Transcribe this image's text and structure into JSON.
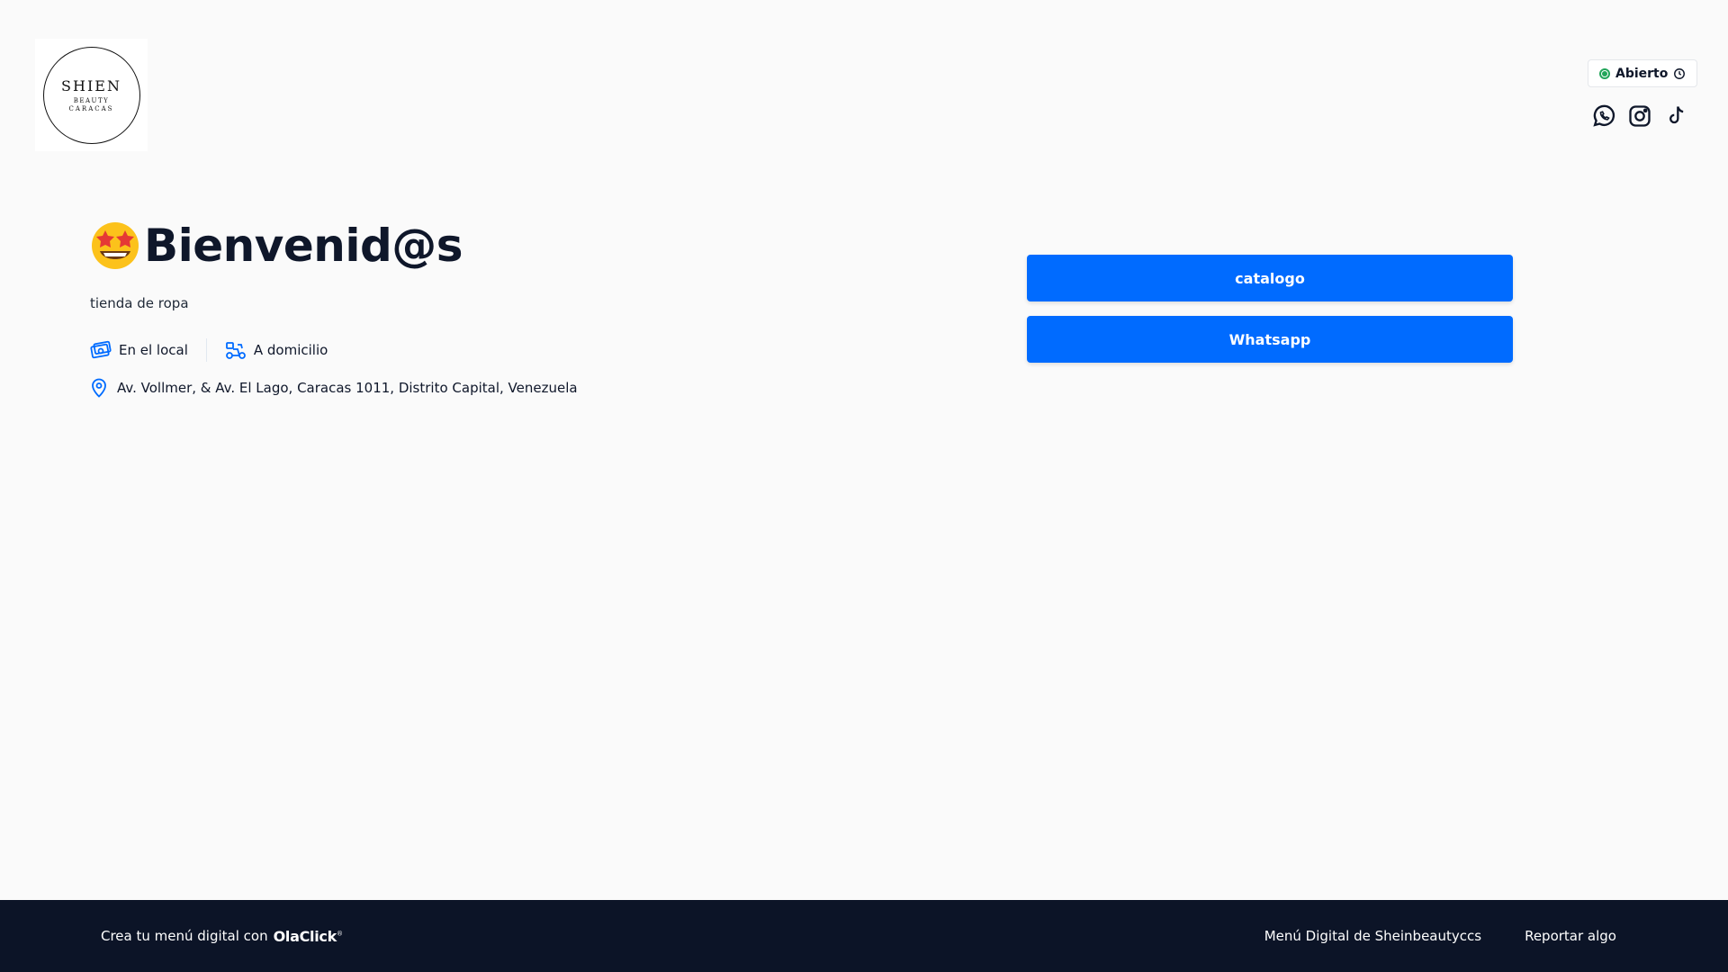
{
  "header": {
    "logo": {
      "line1": "SHIEN",
      "line2": "BEAUTY",
      "line3": "CARACAS"
    },
    "status": {
      "label": "Abierto",
      "color": "#22a55a"
    },
    "socials": [
      "whatsapp-icon",
      "instagram-icon",
      "tiktok-icon"
    ]
  },
  "hero": {
    "emoji": "star-struck-emoji",
    "title": "Bienvenid@s",
    "subtitle": "tienda de ropa",
    "modes": [
      {
        "label": "En el local",
        "icon": "store-ticket-icon"
      },
      {
        "label": "A domicilio",
        "icon": "delivery-scooter-icon"
      }
    ],
    "address": "Av. Vollmer, & Av. El Lago, Caracas 1011, Distrito Capital, Venezuela"
  },
  "actions": {
    "catalog_label": "catalogo",
    "whatsapp_label": "Whatsapp",
    "color": "#006bff"
  },
  "footer": {
    "cta_text": "Crea tu menú digital con",
    "brand": "OlaClick",
    "brand_mark": "®",
    "menu_link": "Menú Digital de Sheinbeautyccs",
    "report_link": "Reportar algo",
    "background": "#0c1427"
  }
}
